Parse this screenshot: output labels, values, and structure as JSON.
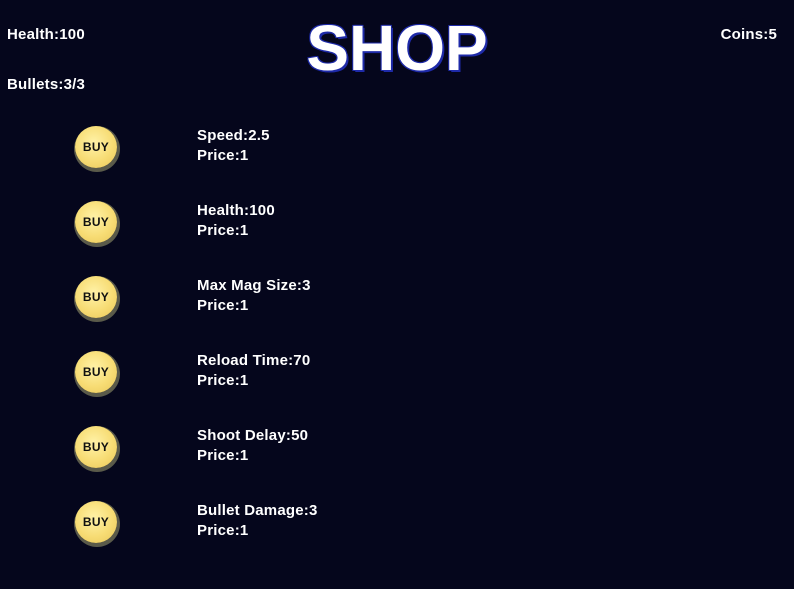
{
  "hud": {
    "health": "Health:100",
    "bullets": "Bullets:3/3",
    "coins": "Coins:5"
  },
  "title": "SHOP",
  "colors": {
    "background": "#05061c",
    "button": "#f7dc74",
    "title_outline": "#1e2aa8"
  },
  "items": [
    {
      "button_label": "BUY",
      "stat": "Speed:2.5",
      "price": "Price:1"
    },
    {
      "button_label": "BUY",
      "stat": "Health:100",
      "price": "Price:1"
    },
    {
      "button_label": "BUY",
      "stat": "Max Mag Size:3",
      "price": "Price:1"
    },
    {
      "button_label": "BUY",
      "stat": "Reload Time:70",
      "price": "Price:1"
    },
    {
      "button_label": "BUY",
      "stat": "Shoot Delay:50",
      "price": "Price:1"
    },
    {
      "button_label": "BUY",
      "stat": "Bullet Damage:3",
      "price": "Price:1"
    }
  ]
}
